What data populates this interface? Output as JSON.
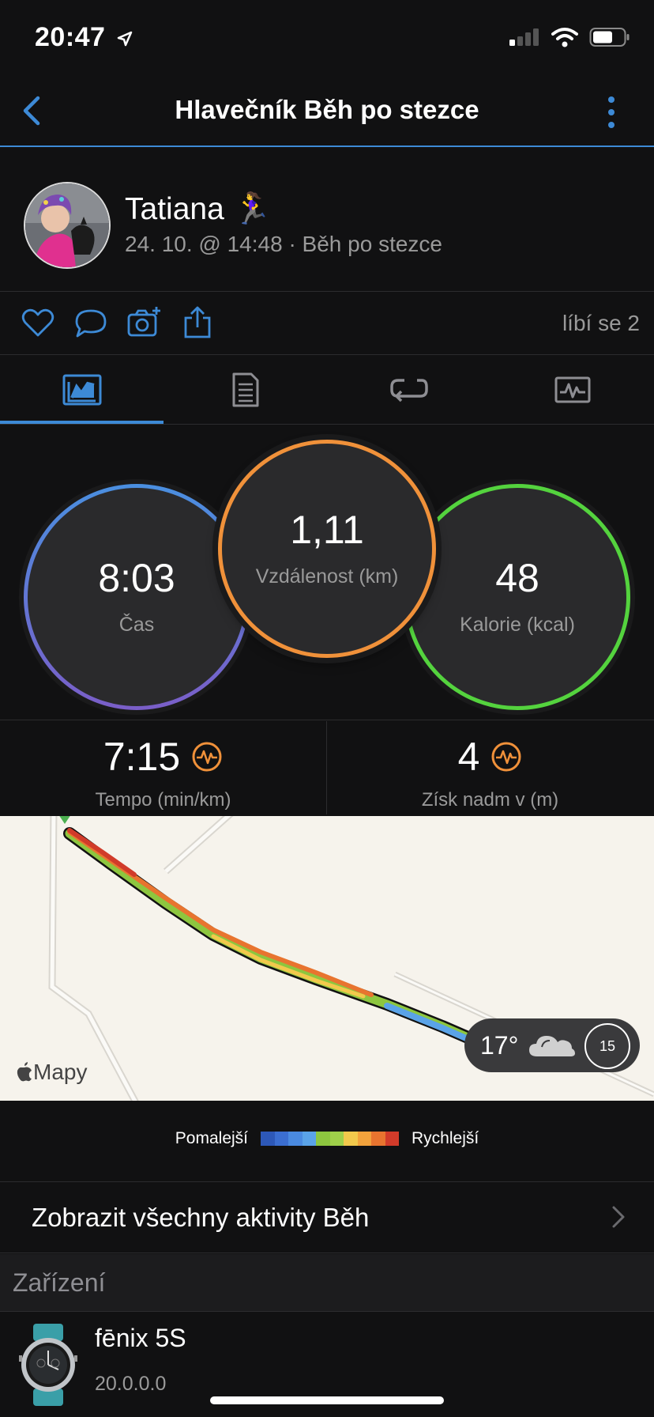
{
  "status": {
    "time": "20:47"
  },
  "nav": {
    "title": "Hlavečník Běh po stezce"
  },
  "profile": {
    "name": "Tatiana 🏃‍♀️",
    "meta": "24. 10. @ 14:48 · Běh po stezce"
  },
  "actions": {
    "likes": "líbí se 2",
    "icons": [
      "heart-icon",
      "comment-icon",
      "camera-add-icon",
      "share-icon"
    ]
  },
  "tabs": [
    {
      "icon": "stats-icon",
      "active": true
    },
    {
      "icon": "details-icon",
      "active": false
    },
    {
      "icon": "laps-icon",
      "active": false
    },
    {
      "icon": "charts-icon",
      "active": false
    }
  ],
  "summary": {
    "time": {
      "value": "8:03",
      "label": "Čas"
    },
    "distance": {
      "value": "1,11",
      "label": "Vzdálenost (km)"
    },
    "calories": {
      "value": "48",
      "label": "Kalorie (kcal)"
    }
  },
  "metrics": {
    "pace": {
      "value": "7:15",
      "label": "Tempo (min/km)"
    },
    "ascent": {
      "value": "4",
      "label": "Získ nadm v (m)"
    }
  },
  "map": {
    "attribution": "Mapy",
    "weather": {
      "temp": "17°",
      "wind": "15"
    }
  },
  "legend": {
    "slow": "Pomalejší",
    "fast": "Rychlejší",
    "colors": [
      "#2d58b8",
      "#3b6ed1",
      "#4a8ae0",
      "#5aa3e8",
      "#8dc63f",
      "#9fd04a",
      "#f2c94c",
      "#f2a23c",
      "#e8742f",
      "#d13b2a"
    ]
  },
  "links": {
    "all_activities": "Zobrazit všechny aktivity Běh"
  },
  "device": {
    "section": "Zařízení",
    "name": "fēnix 5S",
    "version": "20.0.0.0"
  },
  "colors": {
    "accent": "#3d8ad6",
    "time_ring": "#4a8fe0",
    "distance_ring": "#f0913a",
    "calories_ring": "#54d33e"
  }
}
